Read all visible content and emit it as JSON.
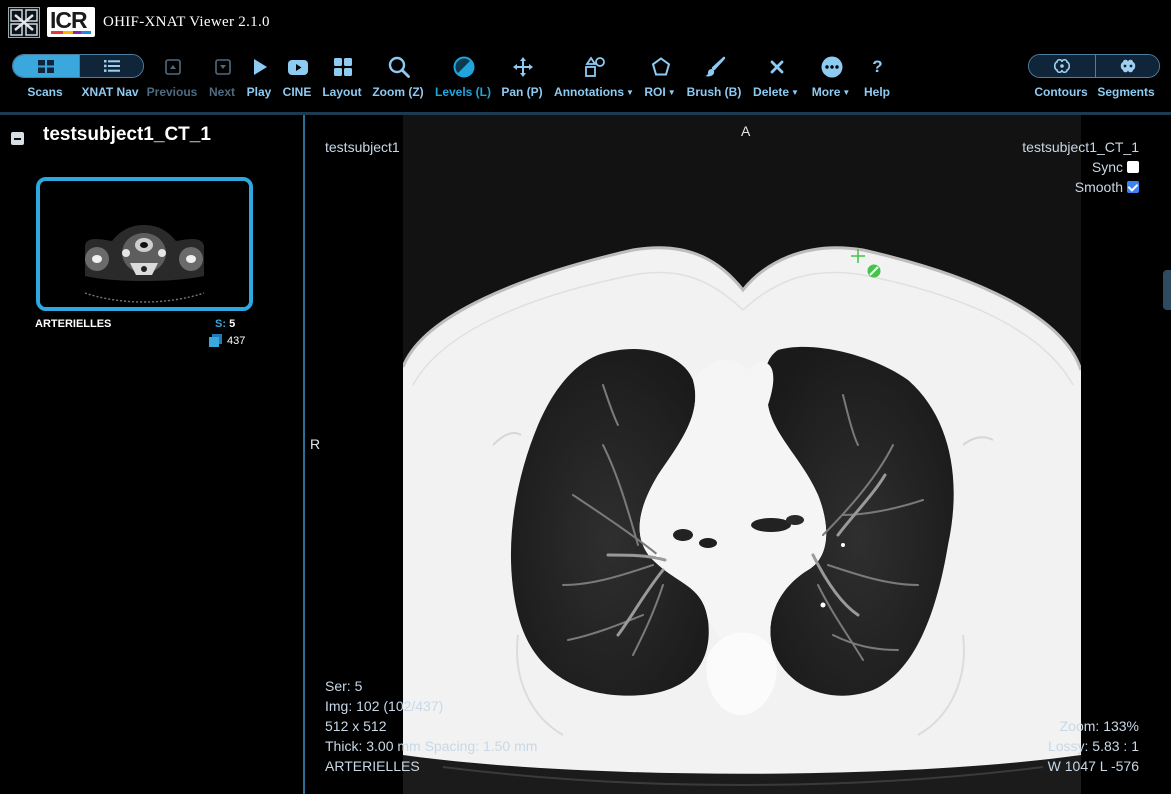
{
  "app": {
    "title": "OHIF-XNAT Viewer 2.1.0",
    "logo_text": "ICR"
  },
  "toolbar": {
    "scans_label": "Scans",
    "xnat_nav_label": "XNAT Nav",
    "previous_label": "Previous",
    "next_label": "Next",
    "play_label": "Play",
    "cine_label": "CINE",
    "layout_label": "Layout",
    "zoom_label": "Zoom (Z)",
    "levels_label": "Levels (L)",
    "pan_label": "Pan (P)",
    "annotations_label": "Annotations",
    "roi_label": "ROI",
    "brush_label": "Brush (B)",
    "delete_label": "Delete",
    "more_label": "More",
    "help_label": "Help",
    "contours_label": "Contours",
    "segments_label": "Segments",
    "active_tool": "Levels (L)",
    "accent_color": "#3aa7dd"
  },
  "study": {
    "title": "testsubject1_CT_1",
    "series": [
      {
        "description": "ARTERIELLES",
        "number_key": "S:",
        "number": "5",
        "image_count": "437",
        "icon": "stack-icon"
      }
    ]
  },
  "viewport": {
    "orientation_top": "A",
    "orientation_left": "R",
    "top_left": "testsubject1",
    "top_right": "testsubject1_CT_1",
    "sync_label": "Sync",
    "sync_checked": false,
    "smooth_label": "Smooth",
    "smooth_checked": true,
    "bottom_left": {
      "series": "Ser: 5",
      "image": "Img: 102 (102/437)",
      "dimensions": "512 x 512",
      "thickness": "Thick: 3.00 mm Spacing: 1.50 mm",
      "description": "ARTERIELLES"
    },
    "bottom_right": {
      "zoom": "Zoom: 133%",
      "lossy": "Lossy: 5.83 : 1",
      "window": "W 1047 L -576"
    }
  }
}
